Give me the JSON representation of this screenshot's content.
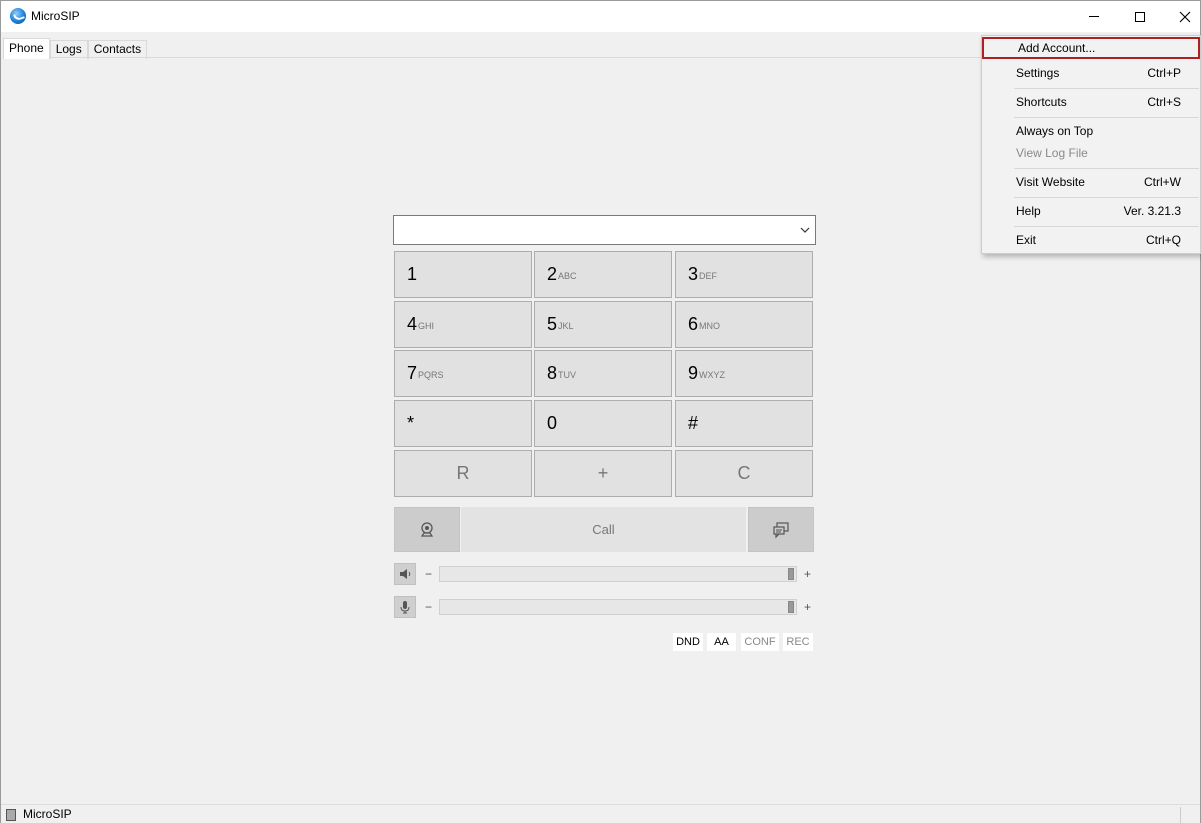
{
  "window": {
    "title": "MicroSIP",
    "controls": {
      "minimize": "minimize",
      "maximize": "maximize",
      "close": "close"
    }
  },
  "tabs": [
    {
      "label": "Phone",
      "active": true
    },
    {
      "label": "Logs",
      "active": false
    },
    {
      "label": "Contacts",
      "active": false
    }
  ],
  "dialer": {
    "number_value": "",
    "keys": [
      {
        "digit": "1",
        "letters": ""
      },
      {
        "digit": "2",
        "letters": "ABC"
      },
      {
        "digit": "3",
        "letters": "DEF"
      },
      {
        "digit": "4",
        "letters": "GHI"
      },
      {
        "digit": "5",
        "letters": "JKL"
      },
      {
        "digit": "6",
        "letters": "MNO"
      },
      {
        "digit": "7",
        "letters": "PQRS"
      },
      {
        "digit": "8",
        "letters": "TUV"
      },
      {
        "digit": "9",
        "letters": "WXYZ"
      },
      {
        "digit": "*",
        "letters": ""
      },
      {
        "digit": "0",
        "letters": ""
      },
      {
        "digit": "#",
        "letters": ""
      }
    ],
    "function_keys": [
      "R",
      "+",
      "C"
    ],
    "call_label": "Call",
    "speaker": {
      "minus": "−",
      "plus": "+",
      "level": 1.0
    },
    "microphone": {
      "minus": "−",
      "plus": "+",
      "level": 1.0
    },
    "toggles": [
      {
        "label": "DND",
        "enabled": true
      },
      {
        "label": "AA",
        "enabled": true
      },
      {
        "label": "CONF",
        "enabled": false
      },
      {
        "label": "REC",
        "enabled": false
      }
    ]
  },
  "menu": {
    "items": [
      {
        "label": "Add Account...",
        "shortcut": "",
        "highlighted": true
      },
      {
        "label": "Settings",
        "shortcut": "Ctrl+P"
      },
      {
        "label": "Shortcuts",
        "shortcut": "Ctrl+S"
      },
      {
        "label": "Always on Top",
        "shortcut": ""
      },
      {
        "label": "View Log File",
        "shortcut": "",
        "disabled": true
      },
      {
        "label": "Visit Website",
        "shortcut": "Ctrl+W"
      },
      {
        "label": "Help",
        "shortcut": "Ver. 3.21.3"
      },
      {
        "label": "Exit",
        "shortcut": "Ctrl+Q"
      }
    ]
  },
  "statusbar": {
    "text": "MicroSIP"
  },
  "colors": {
    "highlight_border": "#b01f24",
    "key_bg": "#e1e1e1",
    "window_bg": "#f0f0f0"
  }
}
